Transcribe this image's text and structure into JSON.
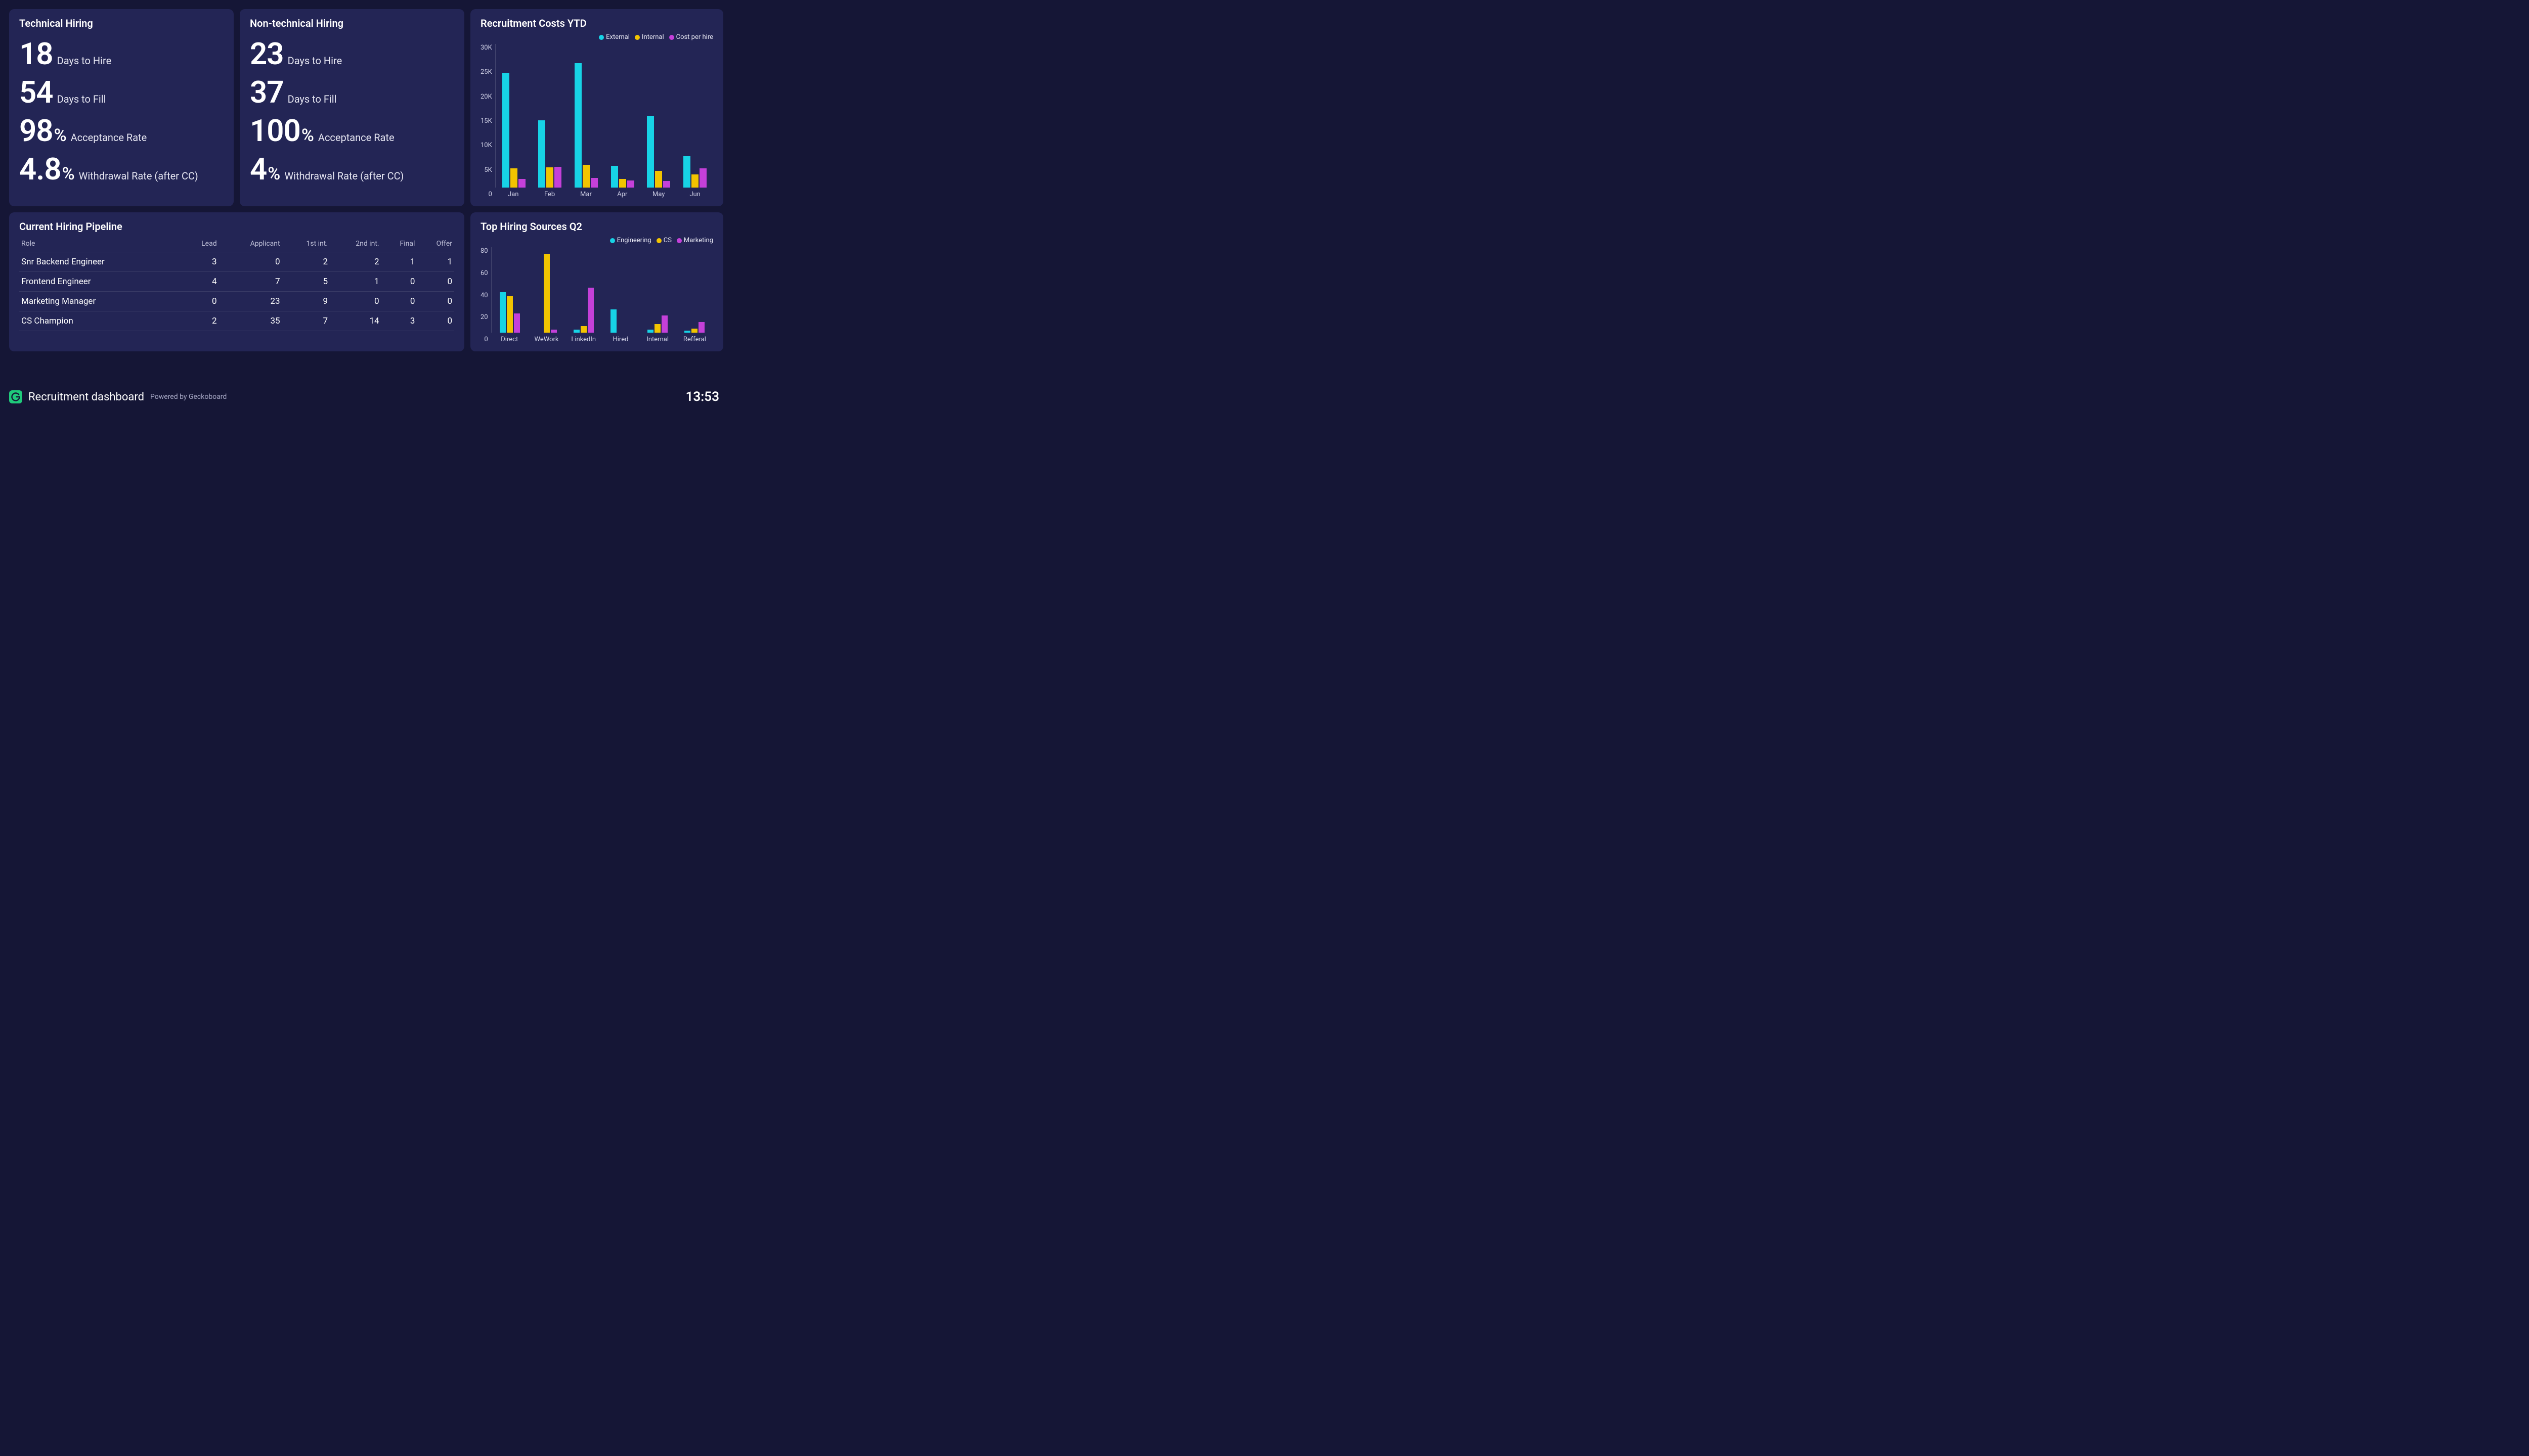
{
  "technical": {
    "title": "Technical Hiring",
    "metrics": [
      {
        "value": "18",
        "unit": "",
        "label": "Days to Hire"
      },
      {
        "value": "54",
        "unit": "",
        "label": "Days to Fill"
      },
      {
        "value": "98",
        "unit": "%",
        "label": "Acceptance Rate"
      },
      {
        "value": "4.8",
        "unit": "%",
        "label": "Withdrawal Rate (after CC)"
      }
    ]
  },
  "nontechnical": {
    "title": "Non-technical Hiring",
    "metrics": [
      {
        "value": "23",
        "unit": "",
        "label": "Days to Hire"
      },
      {
        "value": "37",
        "unit": "",
        "label": "Days to Fill"
      },
      {
        "value": "100",
        "unit": "%",
        "label": "Acceptance Rate"
      },
      {
        "value": "4",
        "unit": "%",
        "label": "Withdrawal Rate (after CC)"
      }
    ]
  },
  "costs": {
    "title": "Recruitment Costs YTD",
    "legend": [
      "External",
      "Internal",
      "Cost per hire"
    ]
  },
  "pipeline": {
    "title": "Current Hiring Pipeline",
    "headers": [
      "Role",
      "Lead",
      "Applicant",
      "1st int.",
      "2nd int.",
      "Final",
      "Offer"
    ],
    "rows": [
      [
        "Snr Backend Engineer",
        "3",
        "0",
        "2",
        "2",
        "1",
        "1"
      ],
      [
        "Frontend Engineer",
        "4",
        "7",
        "5",
        "1",
        "0",
        "0"
      ],
      [
        "Marketing Manager",
        "0",
        "23",
        "9",
        "0",
        "0",
        "0"
      ],
      [
        "CS Champion",
        "2",
        "35",
        "7",
        "14",
        "3",
        "0"
      ]
    ]
  },
  "sources": {
    "title": "Top Hiring Sources Q2",
    "legend": [
      "Engineering",
      "CS",
      "Marketing"
    ]
  },
  "footer": {
    "title": "Recruitment dashboard",
    "subtitle": "Powered by Geckoboard",
    "time": "13:53"
  },
  "chart_data": [
    {
      "type": "bar",
      "title": "Recruitment Costs YTD",
      "categories": [
        "Jan",
        "Feb",
        "Mar",
        "Apr",
        "May",
        "Jun"
      ],
      "series": [
        {
          "name": "External",
          "values": [
            24000,
            14000,
            26000,
            4500,
            15000,
            6500
          ]
        },
        {
          "name": "Internal",
          "values": [
            4000,
            4200,
            4800,
            1800,
            3500,
            2700
          ]
        },
        {
          "name": "Cost per hire",
          "values": [
            1800,
            4300,
            2000,
            1500,
            1400,
            4000
          ]
        }
      ],
      "ylabel": "",
      "ylim": [
        0,
        30000
      ],
      "yticks": [
        "30K",
        "25K",
        "20K",
        "15K",
        "10K",
        "5K",
        "0"
      ],
      "colors": {
        "External": "#17d3e6",
        "Internal": "#f2c400",
        "Cost per hire": "#c440d9"
      }
    },
    {
      "type": "bar",
      "title": "Top Hiring Sources Q2",
      "categories": [
        "Direct",
        "WeWork",
        "LinkedIn",
        "Hired",
        "Internal",
        "Refferal"
      ],
      "series": [
        {
          "name": "Engineering",
          "values": [
            38,
            0,
            3,
            22,
            3,
            2
          ]
        },
        {
          "name": "CS",
          "values": [
            34,
            74,
            6,
            0,
            8,
            4
          ]
        },
        {
          "name": "Marketing",
          "values": [
            18,
            3,
            42,
            0,
            16,
            10
          ]
        }
      ],
      "ylabel": "",
      "ylim": [
        0,
        80
      ],
      "yticks": [
        "80",
        "60",
        "40",
        "20",
        "0"
      ],
      "colors": {
        "Engineering": "#17d3e6",
        "CS": "#f2c400",
        "Marketing": "#c440d9"
      }
    }
  ]
}
